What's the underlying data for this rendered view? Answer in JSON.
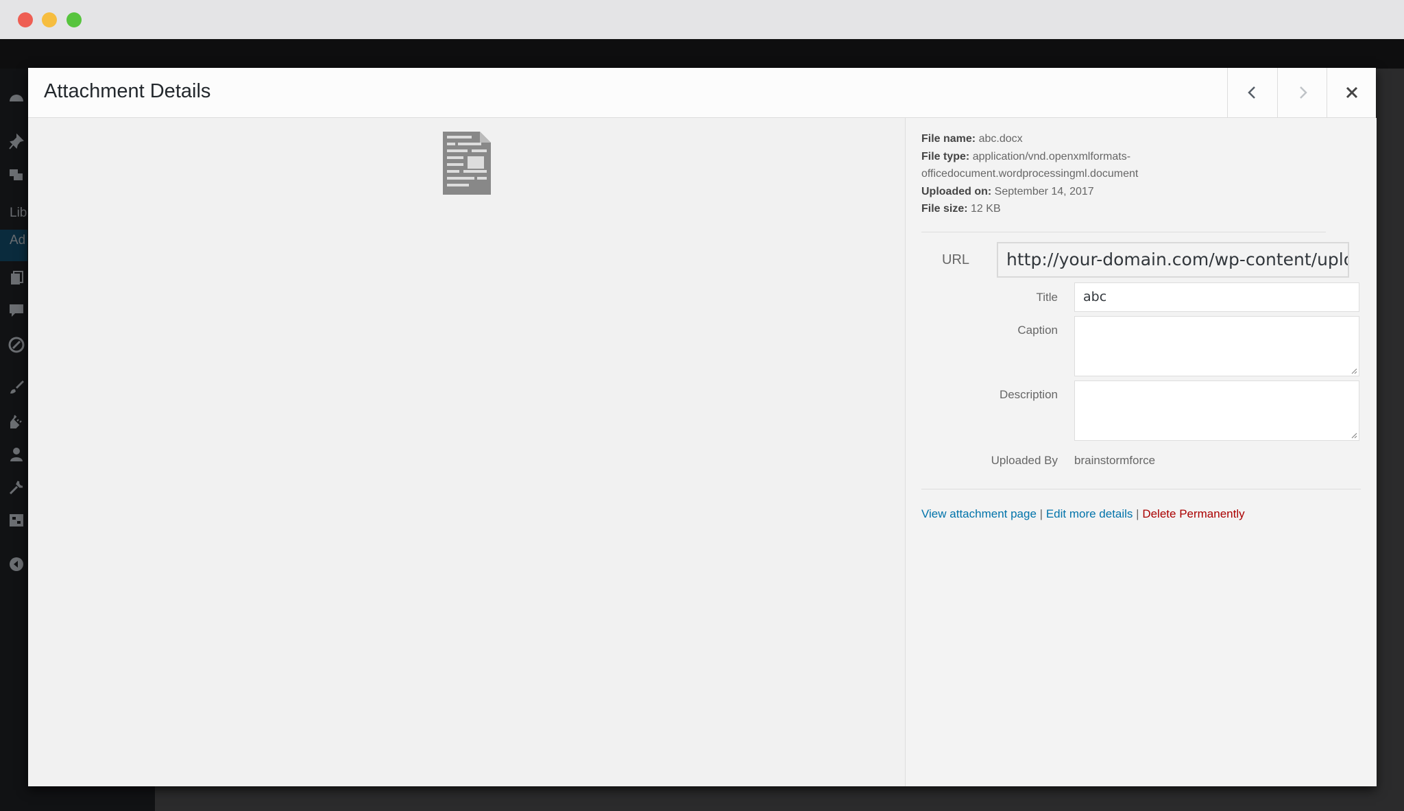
{
  "modal": {
    "title": "Attachment Details"
  },
  "file_info": {
    "file_name_label": "File name:",
    "file_name": "abc.docx",
    "file_type_label": "File type:",
    "file_type_line1": "application/vnd.openxmlformats-",
    "file_type_line2": "officedocument.wordprocessingml.document",
    "uploaded_on_label": "Uploaded on:",
    "uploaded_on": "September 14, 2017",
    "file_size_label": "File size:",
    "file_size": "12 KB"
  },
  "fields": {
    "url_label": "URL",
    "url_value": "http://your-domain.com/wp-content/upload",
    "title_label": "Title",
    "title_value": "abc",
    "caption_label": "Caption",
    "caption_value": "",
    "description_label": "Description",
    "description_value": "",
    "uploaded_by_label": "Uploaded By",
    "uploaded_by_value": "brainstormforce"
  },
  "actions": {
    "view_attachment": "View attachment page",
    "edit_details": "Edit more details",
    "delete": "Delete Permanently",
    "separator": "|"
  },
  "admin_menu": {
    "library_label": "Lib",
    "add_label": "Ad"
  },
  "icons": {
    "prev": "chevron-left-icon",
    "next": "chevron-right-icon",
    "close": "close-icon",
    "file": "document-icon"
  }
}
